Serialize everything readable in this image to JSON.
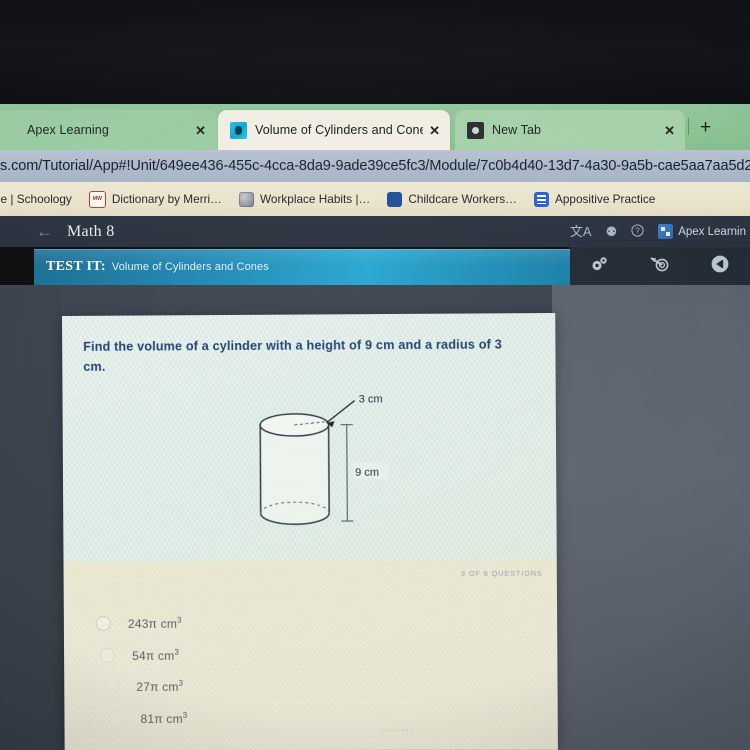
{
  "browser": {
    "tabs": [
      {
        "title": "Apex Learning",
        "favicon": "blank-favicon",
        "close_label": "✕",
        "active": false
      },
      {
        "title": "Volume of Cylinders and Cones",
        "favicon": "cylinder-favicon",
        "close_label": "✕",
        "active": true
      },
      {
        "title": "New Tab",
        "favicon": "chrome-favicon",
        "close_label": "✕",
        "active": false
      }
    ],
    "new_tab_button": "+",
    "url": "s.com/Tutorial/App#!Unit/649ee436-455c-4cca-8da9-9ade39ce5fc3/Module/7c0b4d40-13d7-4a30-9a5b-cae5aa7aa5d2",
    "bookmarks": [
      {
        "label": "ne | Schoology",
        "icon": "schoology-icon"
      },
      {
        "label": "Dictionary by Merri…",
        "icon": "merriam-webster-icon"
      },
      {
        "label": "Workplace Habits |…",
        "icon": "globe-icon"
      },
      {
        "label": "Childcare Workers…",
        "icon": "blue-circle-icon"
      },
      {
        "label": "Appositive Practice",
        "icon": "google-slides-icon"
      }
    ]
  },
  "app": {
    "back_arrow": "←",
    "title": "Math 8",
    "header_icons": [
      {
        "name": "translate-icon",
        "glyph": "文A"
      },
      {
        "name": "read-aloud-icon",
        "glyph": "⚉"
      },
      {
        "name": "help-icon",
        "glyph": "?"
      }
    ],
    "brand": "Apex Learnin",
    "toolbar_icons": [
      {
        "name": "settings-gears-icon",
        "glyph": "⚙"
      },
      {
        "name": "target-dart-icon",
        "glyph": "◎"
      },
      {
        "name": "rewind-icon",
        "glyph": "◀"
      }
    ],
    "banner": {
      "label": "TEST IT:",
      "subtitle": "Volume of Cylinders and Cones",
      "accent_color": "#25a6d2"
    }
  },
  "question": {
    "prompt": "Find the volume of a cylinder with a height of 9 cm and a radius of 3 cm.",
    "counter": "3 of 8 QUESTIONS",
    "figure": {
      "type": "cylinder-diagram",
      "radius_label": "3 cm",
      "height_label": "9 cm"
    },
    "options": [
      {
        "label": "243π cm",
        "exponent": "3",
        "selected": false
      },
      {
        "label": "54π cm",
        "exponent": "3",
        "selected": false
      },
      {
        "label": "27π cm",
        "exponent": "3",
        "selected": false
      },
      {
        "label": "81π cm",
        "exponent": "3",
        "selected": false
      }
    ]
  },
  "misc": {
    "bottom_faint_text": "••••••••"
  }
}
